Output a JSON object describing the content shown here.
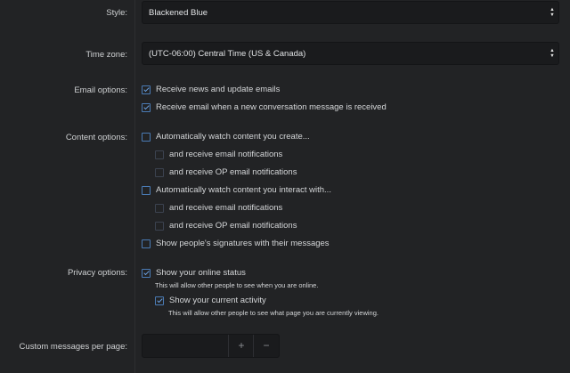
{
  "style": {
    "label": "Style:",
    "value": "Blackened Blue"
  },
  "timezone": {
    "label": "Time zone:",
    "value": "(UTC-06:00) Central Time (US & Canada)"
  },
  "email_options": {
    "label": "Email options:",
    "items": [
      {
        "text": "Receive news and update emails",
        "checked": true
      },
      {
        "text": "Receive email when a new conversation message is received",
        "checked": true
      }
    ]
  },
  "content_options": {
    "label": "Content options:",
    "items": [
      {
        "text": "Automatically watch content you create...",
        "checked": false
      },
      {
        "text": "and receive email notifications",
        "checked": false
      },
      {
        "text": "and receive OP email notifications",
        "checked": false
      },
      {
        "text": "Automatically watch content you interact with...",
        "checked": false
      },
      {
        "text": "and receive email notifications",
        "checked": false
      },
      {
        "text": "and receive OP email notifications",
        "checked": false
      },
      {
        "text": "Show people's signatures with their messages",
        "checked": false
      }
    ]
  },
  "privacy_options": {
    "label": "Privacy options:",
    "online_status": {
      "text": "Show your online status",
      "checked": true,
      "hint": "This will allow other people to see when you are online."
    },
    "current_activity": {
      "text": "Show your current activity",
      "checked": true,
      "hint": "This will allow other people to see what page you are currently viewing."
    }
  },
  "messages_per_page": {
    "label": "Custom messages per page:",
    "value": "",
    "plus": "+",
    "minus": "−"
  },
  "colors": {
    "checkbox_border": "#4a7bb5",
    "check": "#6aa0e0",
    "background": "#222325",
    "input_bg": "#1a1b1d"
  }
}
